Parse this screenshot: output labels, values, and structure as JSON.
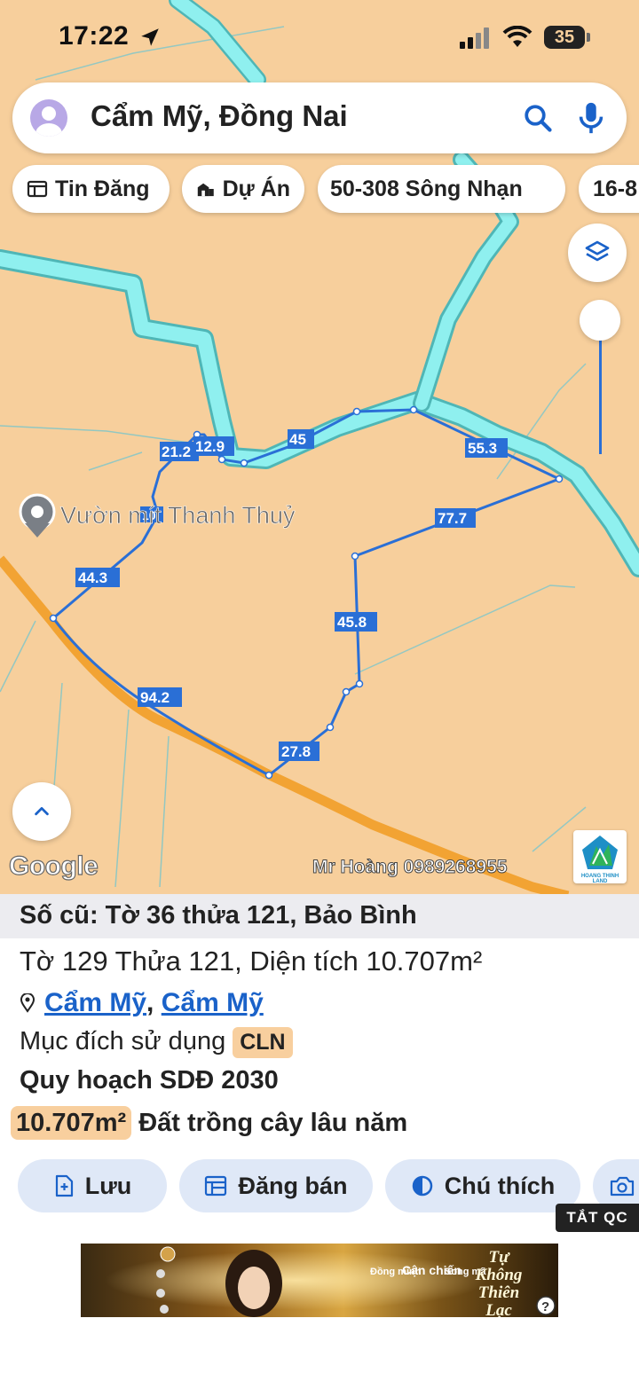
{
  "status_bar": {
    "time": "17:22",
    "battery": "35"
  },
  "search": {
    "title": "Cẩm Mỹ, Đồng Nai"
  },
  "chips": [
    {
      "label": "Tin Đăng",
      "icon": "news-icon"
    },
    {
      "label": "Dự Án",
      "icon": "building-icon"
    },
    {
      "label": "50-308 Sông Nhạn"
    },
    {
      "label": "16-8"
    }
  ],
  "map": {
    "place_label": "Vườn mít Thanh Thuỷ",
    "google_logo": "Google",
    "watermark": "Mr Hoàng 0989268955",
    "logo_caption": "HOANG THINH LAND",
    "edge_labels": [
      "21.2",
      "12.9",
      "45",
      "55.3",
      "77.7",
      "10",
      "44.3",
      "45.8",
      "94.2",
      "27.8"
    ]
  },
  "parcel": {
    "old_number": "Số cũ: Tờ 36 thửa 121, Bảo Bình",
    "summary": "Tờ 129 Thửa 121, Diện tích 10.707m²",
    "location_1": "Cẩm Mỹ",
    "location_sep": ",",
    "location_2": "Cẩm Mỹ",
    "usage_label": "Mục đích sử dụng",
    "usage_code": "CLN",
    "planning_title": "Quy hoạch SDĐ 2030",
    "area_value": "10.707m²",
    "area_desc": "Đất trồng cây lâu năm"
  },
  "actions": [
    {
      "label": "Lưu",
      "icon": "save-icon"
    },
    {
      "label": "Đăng bán",
      "icon": "list-icon"
    },
    {
      "label": "Chú thích",
      "icon": "contrast-icon"
    },
    {
      "label": "",
      "icon": "camera-icon"
    }
  ],
  "ad": {
    "close_label": "TẮT QC",
    "ad_title": "Tự Không Thiên Lạc",
    "ad_text_1": "Đồng minh",
    "ad_text_2": "Cận chiến",
    "ad_text_3": "Song mã"
  },
  "colors": {
    "map_bg": "#f7cf9c",
    "river": "#8ff0ef",
    "parcel_line": "#2a6fd6",
    "road": "#f2a333",
    "chip_bg": "#dfe8f7"
  }
}
